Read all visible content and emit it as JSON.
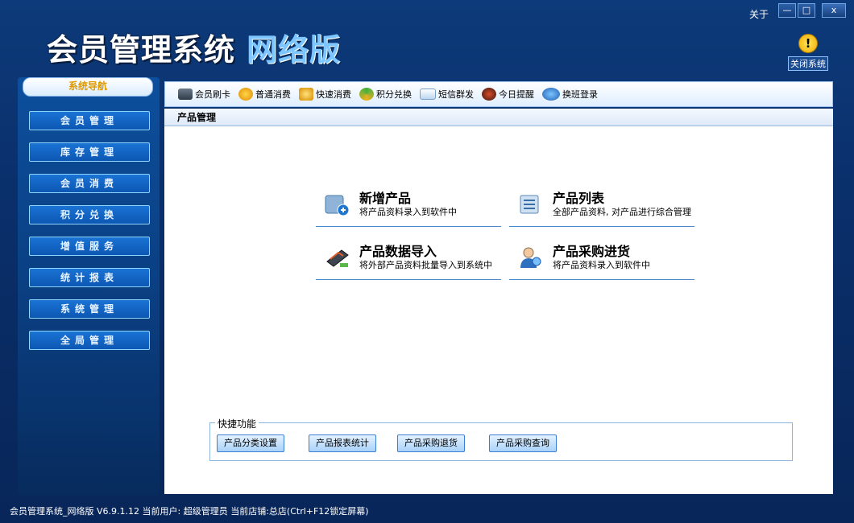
{
  "app": {
    "title_main": "会员管理系统",
    "title_sub": "网络版",
    "about": "关于",
    "close_system": "关闭系统"
  },
  "window_controls": {
    "minimize": "—",
    "maximize": "□",
    "close": "x"
  },
  "sidebar": {
    "header": "系统导航",
    "items": [
      {
        "label": "会员管理"
      },
      {
        "label": "库存管理"
      },
      {
        "label": "会员消费"
      },
      {
        "label": "积分兑换"
      },
      {
        "label": "增值服务"
      },
      {
        "label": "统计报表"
      },
      {
        "label": "系统管理"
      },
      {
        "label": "全局管理"
      }
    ]
  },
  "toolbar": [
    {
      "label": "会员刷卡",
      "icon": "card-reader-icon"
    },
    {
      "label": "普通消费",
      "icon": "money-bag-icon"
    },
    {
      "label": "快速消费",
      "icon": "fast-pay-icon"
    },
    {
      "label": "积分兑换",
      "icon": "exchange-icon"
    },
    {
      "label": "短信群发",
      "icon": "envelope-icon"
    },
    {
      "label": "今日提醒",
      "icon": "clock-icon"
    },
    {
      "label": "换班登录",
      "icon": "shift-login-icon"
    }
  ],
  "breadcrumb": "产品管理",
  "cards": [
    {
      "title": "新增产品",
      "desc": "将产品资料录入到软件中",
      "icon": "add-product-icon"
    },
    {
      "title": "产品列表",
      "desc": "全部产品资料, 对产品进行综合管理",
      "icon": "product-list-icon"
    },
    {
      "title": "产品数据导入",
      "desc": "将外部产品资料批量导入到系统中",
      "icon": "import-data-icon"
    },
    {
      "title": "产品采购进货",
      "desc": "将产品资料录入到软件中",
      "icon": "purchase-icon"
    }
  ],
  "quick": {
    "legend": "快捷功能",
    "buttons": [
      "产品分类设置",
      "产品报表统计",
      "产品采购退货",
      "产品采购查询"
    ]
  },
  "status_bar": "会员管理系统_网络版 V6.9.1.12 当前用户: 超级管理员 当前店铺:总店(Ctrl+F12锁定屏幕)"
}
